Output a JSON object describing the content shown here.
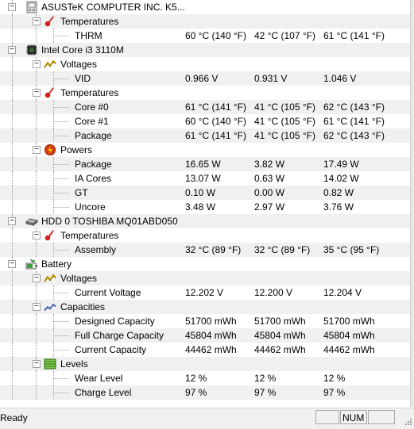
{
  "status": {
    "text": "Ready",
    "num_label": "NUM"
  },
  "rows": [
    {
      "depth": 0,
      "label": "ASUSTeK COMPUTER INC. K5...",
      "icon": "motherboard-icon",
      "expander": "-"
    },
    {
      "depth": 1,
      "label": "Temperatures",
      "icon": "thermometer-icon",
      "expander": "-"
    },
    {
      "depth": 2,
      "label": "THRM",
      "values": [
        "60 °C  (140 °F)",
        "42 °C  (107 °F)",
        "61 °C  (141 °F)"
      ]
    },
    {
      "depth": 0,
      "label": "Intel Core i3 3110M",
      "icon": "cpu-icon",
      "expander": "-"
    },
    {
      "depth": 1,
      "label": "Voltages",
      "icon": "voltage-icon",
      "expander": "-"
    },
    {
      "depth": 2,
      "label": "VID",
      "values": [
        "0.966 V",
        "0.931 V",
        "1.046 V"
      ]
    },
    {
      "depth": 1,
      "label": "Temperatures",
      "icon": "thermometer-icon",
      "expander": "-"
    },
    {
      "depth": 2,
      "label": "Core #0",
      "values": [
        "61 °C  (141 °F)",
        "41 °C  (105 °F)",
        "62 °C  (143 °F)"
      ]
    },
    {
      "depth": 2,
      "label": "Core #1",
      "values": [
        "60 °C  (140 °F)",
        "41 °C  (105 °F)",
        "61 °C  (141 °F)"
      ]
    },
    {
      "depth": 2,
      "label": "Package",
      "values": [
        "61 °C  (141 °F)",
        "41 °C  (105 °F)",
        "62 °C  (143 °F)"
      ]
    },
    {
      "depth": 1,
      "label": "Powers",
      "icon": "power-icon",
      "expander": "-"
    },
    {
      "depth": 2,
      "label": "Package",
      "values": [
        "16.65 W",
        "3.82 W",
        "17.49 W"
      ]
    },
    {
      "depth": 2,
      "label": "IA Cores",
      "values": [
        "13.07 W",
        "0.63 W",
        "14.02 W"
      ]
    },
    {
      "depth": 2,
      "label": "GT",
      "values": [
        "0.10 W",
        "0.00 W",
        "0.82 W"
      ]
    },
    {
      "depth": 2,
      "label": "Uncore",
      "values": [
        "3.48 W",
        "2.97 W",
        "3.76 W"
      ]
    },
    {
      "depth": 0,
      "label": "HDD 0 TOSHIBA MQ01ABD050",
      "icon": "hard-drive-icon",
      "expander": "-"
    },
    {
      "depth": 1,
      "label": "Temperatures",
      "icon": "thermometer-icon",
      "expander": "-"
    },
    {
      "depth": 2,
      "label": "Assembly",
      "values": [
        "32 °C  (89 °F)",
        "32 °C  (89 °F)",
        "35 °C  (95 °F)"
      ]
    },
    {
      "depth": 0,
      "label": "Battery",
      "icon": "battery-icon",
      "expander": "-"
    },
    {
      "depth": 1,
      "label": "Voltages",
      "icon": "voltage-icon",
      "expander": "-"
    },
    {
      "depth": 2,
      "label": "Current Voltage",
      "values": [
        "12.202 V",
        "12.200 V",
        "12.204 V"
      ]
    },
    {
      "depth": 1,
      "label": "Capacities",
      "icon": "capacity-icon",
      "expander": "-"
    },
    {
      "depth": 2,
      "label": "Designed Capacity",
      "values": [
        "51700 mWh",
        "51700 mWh",
        "51700 mWh"
      ]
    },
    {
      "depth": 2,
      "label": "Full Charge Capacity",
      "values": [
        "45804 mWh",
        "45804 mWh",
        "45804 mWh"
      ]
    },
    {
      "depth": 2,
      "label": "Current Capacity",
      "values": [
        "44462 mWh",
        "44462 mWh",
        "44462 mWh"
      ]
    },
    {
      "depth": 1,
      "label": "Levels",
      "icon": "levels-icon",
      "expander": "-"
    },
    {
      "depth": 2,
      "label": "Wear Level",
      "values": [
        "12 %",
        "12 %",
        "12 %"
      ]
    },
    {
      "depth": 2,
      "label": "Charge Level",
      "values": [
        "97 %",
        "97 %",
        "97 %"
      ]
    }
  ]
}
